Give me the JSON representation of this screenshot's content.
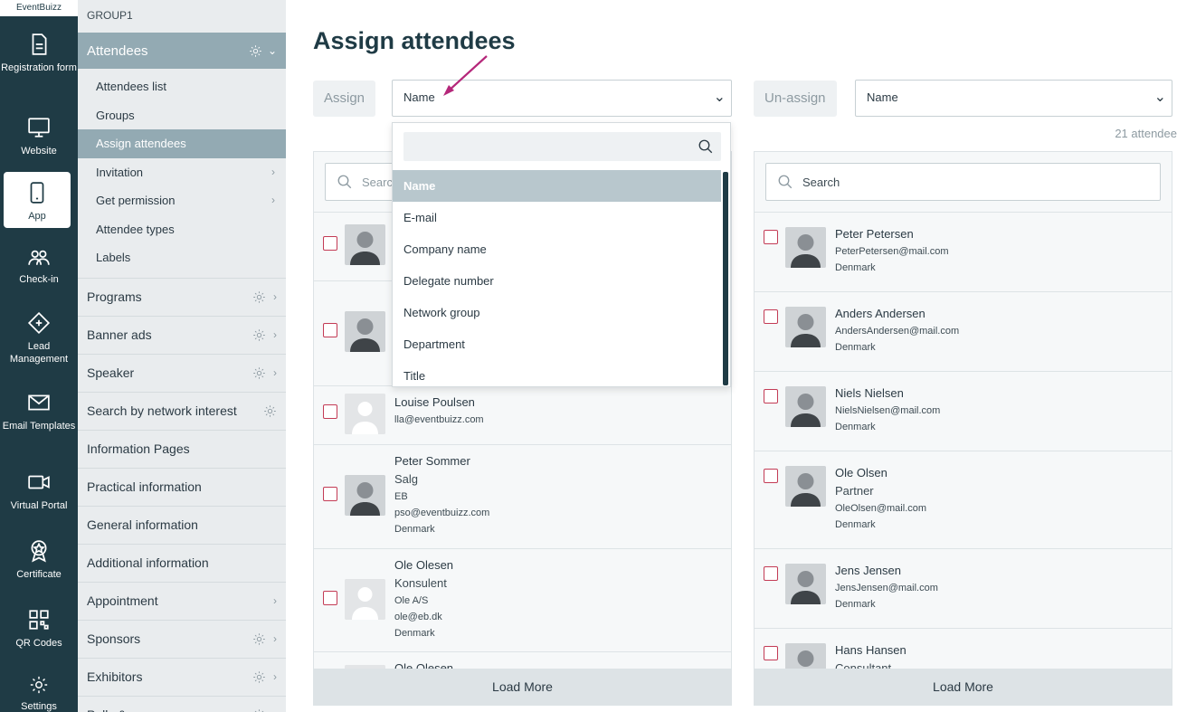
{
  "rail": {
    "brand": "EventBuizz",
    "items": [
      {
        "label": "Registration form",
        "icon": "document-icon"
      },
      {
        "label": "Website",
        "icon": "monitor-icon"
      },
      {
        "label": "App",
        "icon": "phone-icon",
        "active": true
      },
      {
        "label": "Check-in",
        "icon": "people-icon"
      },
      {
        "label": "Lead Management",
        "icon": "lead-icon"
      },
      {
        "label": "Email Templates",
        "icon": "email-icon"
      },
      {
        "label": "Virtual Portal",
        "icon": "video-icon"
      },
      {
        "label": "Certificate",
        "icon": "certificate-icon"
      },
      {
        "label": "QR Codes",
        "icon": "qr-icon"
      },
      {
        "label": "Settings",
        "icon": "gear-icon"
      }
    ]
  },
  "sidebar": {
    "group": "GROUP1",
    "section": "Attendees",
    "sub_items": [
      {
        "label": "Attendees list"
      },
      {
        "label": "Groups"
      },
      {
        "label": "Assign attendees",
        "active": true
      },
      {
        "label": "Invitation",
        "chevron": true
      },
      {
        "label": "Get permission",
        "chevron": true
      },
      {
        "label": "Attendee types"
      },
      {
        "label": "Labels"
      }
    ],
    "rows": [
      {
        "label": "Programs",
        "gear": true,
        "chevron": true
      },
      {
        "label": "Banner ads",
        "gear": true,
        "chevron": true
      },
      {
        "label": "Speaker",
        "gear": true,
        "chevron": true
      },
      {
        "label": "Search by network interest",
        "gear": true,
        "chevron": false
      },
      {
        "label": "Information Pages",
        "gear": false,
        "chevron": false
      },
      {
        "label": "Practical information",
        "gear": false,
        "chevron": false
      },
      {
        "label": "General information",
        "gear": false,
        "chevron": false
      },
      {
        "label": "Additional information",
        "gear": false,
        "chevron": false
      },
      {
        "label": "Appointment",
        "gear": false,
        "chevron": true
      },
      {
        "label": "Sponsors",
        "gear": true,
        "chevron": true
      },
      {
        "label": "Exhibitors",
        "gear": true,
        "chevron": true
      },
      {
        "label": "Polls & surveys",
        "gear": true,
        "chevron": true
      }
    ]
  },
  "main": {
    "title": "Assign attendees",
    "assign_label": "Assign",
    "assign_select": "Name",
    "unassign_label": "Un-assign",
    "unassign_select": "Name",
    "count": "21 attendee",
    "search_placeholder": "Search",
    "load_more": "Load More",
    "dropdown_options": [
      "Name",
      "E-mail",
      "Company name",
      "Delegate number",
      "Network group",
      "Department",
      "Title"
    ],
    "left_list": [
      {
        "name": "",
        "lines": []
      },
      {
        "name": "",
        "lines": []
      },
      {
        "name": "Louise Poulsen",
        "lines": [
          "lla@eventbuizz.com"
        ]
      },
      {
        "name": "Peter Sommer",
        "position": "Salg",
        "lines": [
          "EB",
          "pso@eventbuizz.com",
          "Denmark"
        ]
      },
      {
        "name": "Ole Olesen",
        "position": "Konsulent",
        "lines": [
          "Ole A/S",
          "ole@eb.dk",
          "Denmark"
        ]
      },
      {
        "name": "Ole Olesen",
        "lines": []
      }
    ],
    "right_list": [
      {
        "name": "Peter Petersen",
        "lines": [
          "PeterPetersen@mail.com",
          "Denmark"
        ]
      },
      {
        "name": "Anders Andersen",
        "lines": [
          "AndersAndersen@mail.com",
          "Denmark"
        ]
      },
      {
        "name": "Niels Nielsen",
        "lines": [
          "NielsNielsen@mail.com",
          "Denmark"
        ]
      },
      {
        "name": "Ole Olsen",
        "position": "Partner",
        "lines": [
          "OleOlsen@mail.com",
          "Denmark"
        ]
      },
      {
        "name": "Jens Jensen",
        "lines": [
          "JensJensen@mail.com",
          "Denmark"
        ]
      },
      {
        "name": "Hans Hansen",
        "position": "Consultant",
        "lines": []
      }
    ]
  },
  "colors": {
    "rail": "#1f3b45",
    "accent": "#93aab3",
    "checkbox": "#c33b55",
    "arrow": "#b5277a"
  }
}
